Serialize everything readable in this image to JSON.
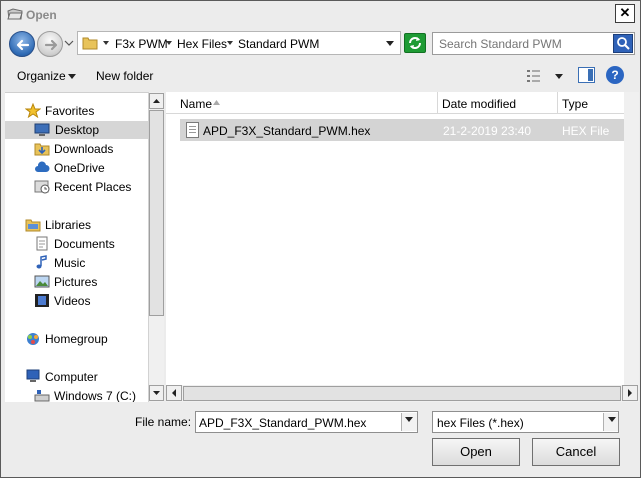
{
  "window": {
    "title": "Open"
  },
  "address": {
    "crumbs": [
      "F3x PWM",
      "Hex Files",
      "Standard PWM"
    ]
  },
  "search": {
    "placeholder": "Search Standard PWM"
  },
  "toolbar": {
    "organize_label": "Organize",
    "new_folder_label": "New folder"
  },
  "sidebar": {
    "items": [
      {
        "label": "Favorites",
        "icon": "star-icon"
      },
      {
        "label": "Desktop",
        "icon": "desktop-icon",
        "selected": true
      },
      {
        "label": "Downloads",
        "icon": "downloads-folder-icon"
      },
      {
        "label": "OneDrive",
        "icon": "cloud-icon"
      },
      {
        "label": "Recent Places",
        "icon": "recent-places-icon"
      },
      {
        "label": "Libraries",
        "icon": "libraries-icon"
      },
      {
        "label": "Documents",
        "icon": "document-icon"
      },
      {
        "label": "Music",
        "icon": "music-icon"
      },
      {
        "label": "Pictures",
        "icon": "pictures-icon"
      },
      {
        "label": "Videos",
        "icon": "video-icon"
      },
      {
        "label": "Homegroup",
        "icon": "homegroup-icon"
      },
      {
        "label": "Computer",
        "icon": "computer-icon"
      },
      {
        "label": "Windows 7 (C:)",
        "icon": "drive-icon"
      }
    ]
  },
  "columns": {
    "name": "Name",
    "date": "Date modified",
    "type": "Type"
  },
  "files": [
    {
      "name": "APD_F3X_Standard_PWM.hex",
      "date": "21-2-2019 23:40",
      "type": "HEX File",
      "selected": true
    }
  ],
  "bottom": {
    "filename_label": "File name:",
    "filename_value": "APD_F3X_Standard_PWM.hex",
    "filetype_value": "hex Files (*.hex)",
    "open_label": "Open",
    "cancel_label": "Cancel"
  },
  "colors": {
    "selection": "#d4d4d4",
    "accent_blue": "#2f62b8",
    "refresh_green": "#1e9b34"
  }
}
